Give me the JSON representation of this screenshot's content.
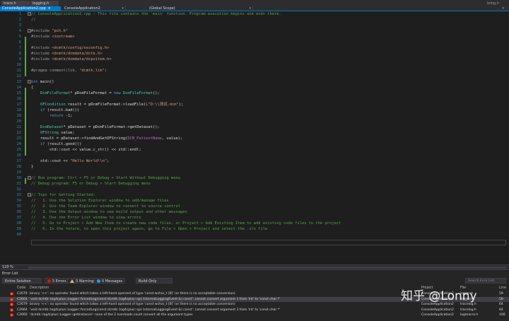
{
  "tabs": [
    {
      "label": "trace.h",
      "active": false
    },
    {
      "label": "logging.h",
      "active": false
    },
    {
      "label": "ConsoleApplication2.cpp",
      "active": true,
      "close": "×"
    }
  ],
  "tabbar_right": "tolog.h",
  "navbar": {
    "project": "ConsoleApplication2",
    "scope": "(Global Scope)",
    "dropdown_glyph": "▾"
  },
  "code_lines": [
    {
      "n": "1",
      "parts": [
        {
          "c": "c-comment",
          "t": "// ConsoleApplication2.cpp : This file contains the 'main' function. Program execution begins and ends there."
        }
      ]
    },
    {
      "n": "2",
      "parts": [
        {
          "c": "c-comment",
          "t": "//"
        }
      ]
    },
    {
      "n": "3",
      "parts": []
    },
    {
      "n": "4",
      "parts": [
        {
          "c": "c-pre",
          "t": "#include "
        },
        {
          "c": "c-str",
          "t": "\"pch.h\""
        }
      ]
    },
    {
      "n": "5",
      "parts": [
        {
          "c": "c-pre",
          "t": "#include "
        },
        {
          "c": "c-str",
          "t": "<iostream>"
        }
      ]
    },
    {
      "n": "6",
      "parts": []
    },
    {
      "n": "7",
      "parts": [
        {
          "c": "c-pre",
          "t": "#include "
        },
        {
          "c": "c-str",
          "t": "<dcmtk/config/osconfig.h>"
        }
      ]
    },
    {
      "n": "8",
      "parts": [
        {
          "c": "c-pre",
          "t": "#include "
        },
        {
          "c": "c-str",
          "t": "<dcmtk/dcmdata/dctk.h>"
        }
      ]
    },
    {
      "n": "9",
      "parts": [
        {
          "c": "c-pre",
          "t": "#include "
        },
        {
          "c": "c-str",
          "t": "<dcmtk/dcmdata/dcpxitem.h>"
        }
      ]
    },
    {
      "n": "10",
      "parts": []
    },
    {
      "n": "11",
      "parts": [
        {
          "c": "c-pre",
          "t": "#pragma "
        },
        {
          "c": "c-pre",
          "t": "comment(lib, "
        },
        {
          "c": "c-str",
          "t": "\"dcmtk.lib\""
        },
        {
          "c": "c-pre",
          "t": ")"
        }
      ]
    },
    {
      "n": "12",
      "parts": []
    },
    {
      "n": "13",
      "parts": [
        {
          "c": "c-kw",
          "t": "int"
        },
        {
          "c": "c-txt",
          "t": " main()"
        }
      ]
    },
    {
      "n": "14",
      "parts": [
        {
          "c": "c-txt",
          "t": "{"
        }
      ]
    },
    {
      "n": "15",
      "parts": [
        {
          "c": "c-txt",
          "t": "    "
        },
        {
          "c": "c-type",
          "t": "DcmFileFormat"
        },
        {
          "c": "c-txt",
          "t": "* pDcmFileFormat = "
        },
        {
          "c": "c-kw",
          "t": "new"
        },
        {
          "c": "c-txt",
          "t": " "
        },
        {
          "c": "c-type",
          "t": "DcmFileFormat"
        },
        {
          "c": "c-txt",
          "t": "();"
        }
      ]
    },
    {
      "n": "16",
      "parts": []
    },
    {
      "n": "17",
      "parts": [
        {
          "c": "c-txt",
          "t": "    "
        },
        {
          "c": "c-type",
          "t": "OFCondition"
        },
        {
          "c": "c-txt",
          "t": " result = pDcmFileFormat->loadFile("
        },
        {
          "c": "c-str",
          "t": "L\"D:\\\\测试.dcm\""
        },
        {
          "c": "c-txt",
          "t": ");"
        }
      ]
    },
    {
      "n": "18",
      "parts": [
        {
          "c": "c-txt",
          "t": "    "
        },
        {
          "c": "c-kw",
          "t": "if"
        },
        {
          "c": "c-txt",
          "t": " (result.bad())"
        }
      ]
    },
    {
      "n": "19",
      "parts": [
        {
          "c": "c-txt",
          "t": "        "
        },
        {
          "c": "c-kw",
          "t": "return"
        },
        {
          "c": "c-txt",
          "t": " -1;"
        }
      ]
    },
    {
      "n": "20",
      "parts": []
    },
    {
      "n": "21",
      "parts": [
        {
          "c": "c-txt",
          "t": "    "
        },
        {
          "c": "c-type",
          "t": "DcmDataset"
        },
        {
          "c": "c-txt",
          "t": "* pDataset = pDcmFileFormat->getDataset();"
        }
      ]
    },
    {
      "n": "22",
      "parts": [
        {
          "c": "c-txt",
          "t": "    "
        },
        {
          "c": "c-type",
          "t": "OFString"
        },
        {
          "c": "c-txt",
          "t": " value;"
        }
      ]
    },
    {
      "n": "23",
      "parts": [
        {
          "c": "c-txt",
          "t": "    result = pDataset->findAndGetOFString("
        },
        {
          "c": "c-macro",
          "t": "DCM_PatientName"
        },
        {
          "c": "c-txt",
          "t": ", value);"
        }
      ]
    },
    {
      "n": "24",
      "parts": [
        {
          "c": "c-txt",
          "t": "    "
        },
        {
          "c": "c-kw",
          "t": "if"
        },
        {
          "c": "c-txt",
          "t": " (result.good())"
        }
      ]
    },
    {
      "n": "25",
      "parts": [
        {
          "c": "c-txt",
          "t": "        std::cout << value.c_str() << std::endl;"
        }
      ]
    },
    {
      "n": "26",
      "parts": []
    },
    {
      "n": "27",
      "parts": [
        {
          "c": "c-txt",
          "t": "    std::cout << "
        },
        {
          "c": "c-str",
          "t": "\"Hello World!\\n\""
        },
        {
          "c": "c-txt",
          "t": ";"
        }
      ]
    },
    {
      "n": "28",
      "parts": [
        {
          "c": "c-txt",
          "t": "}"
        }
      ]
    },
    {
      "n": "29",
      "parts": []
    },
    {
      "n": "30",
      "parts": [
        {
          "c": "c-comment",
          "t": "// Run program: Ctrl + F5 or Debug > Start Without Debugging menu"
        }
      ]
    },
    {
      "n": "31",
      "parts": [
        {
          "c": "c-comment",
          "t": "// Debug program: F5 or Debug > Start Debugging menu"
        }
      ]
    },
    {
      "n": "32",
      "parts": []
    },
    {
      "n": "33",
      "parts": [
        {
          "c": "c-comment",
          "t": "// Tips for Getting Started:"
        }
      ]
    },
    {
      "n": "34",
      "parts": [
        {
          "c": "c-comment",
          "t": "//   1. Use the Solution Explorer window to add/manage files"
        }
      ]
    },
    {
      "n": "35",
      "parts": [
        {
          "c": "c-comment",
          "t": "//   2. Use the Team Explorer window to connect to source control"
        }
      ]
    },
    {
      "n": "36",
      "parts": [
        {
          "c": "c-comment",
          "t": "//   3. Use the Output window to see build output and other messages"
        }
      ]
    },
    {
      "n": "37",
      "parts": [
        {
          "c": "c-comment",
          "t": "//   4. Use the Error List window to view errors"
        }
      ]
    },
    {
      "n": "38",
      "parts": [
        {
          "c": "c-comment",
          "t": "//   5. Go to Project > Add New Item to create new code files, or Project > Add Existing Item to add existing code files to the project"
        }
      ]
    },
    {
      "n": "39",
      "parts": [
        {
          "c": "c-comment",
          "t": "//   6. In the future, to open this project again, go to File > Open > Project and select the .sln file"
        }
      ]
    },
    {
      "n": "40",
      "parts": []
    }
  ],
  "fold_glyph": "−",
  "zoom": "120 %",
  "error_list": {
    "title": "Error List",
    "scope": "Entire Solution",
    "errors_btn": "5 Errors",
    "warnings_btn": "0 Warnings",
    "messages_btn": "0 Messages",
    "build_filter": "Build Only",
    "search_placeholder": "Search Error List",
    "columns": {
      "code": "Code",
      "description": "Description",
      "project": "Project",
      "file": "File",
      "line": "Line"
    },
    "rows": [
      {
        "code": "C2679",
        "desc": "binary '<<': no operator found which takes a left-hand operand of type 'const wchar_t [8]' (or there is no acceptable conversion)",
        "project": "ConsoleApplication2",
        "file": "logger.h",
        "line": "59",
        "sel": false
      },
      {
        "code": "C2664",
        "desc": "'void dcmtk::log4cplus::Logger::forcedLog(const dcmtk::log4cplus::spi::InternalLoggingEvent &) const': cannot convert argument 3 from 'int' to 'const char *'",
        "project": "ConsoleApplication2",
        "file": "logger.h",
        "line": "59",
        "sel": true
      },
      {
        "code": "C2679",
        "desc": "binary '<<': no operator found which takes a left-hand operand of type 'const wchar_t [8]' (or there is no acceptable conversion)",
        "project": "ConsoleApplication2",
        "file": "tracelog.h",
        "line": "64",
        "sel": false
      },
      {
        "code": "C2664",
        "desc": "'void dcmtk::log4cplus::Logger::forcedLog(const dcmtk::log4cplus::spi::InternalLoggingEvent &) const': cannot convert argument 3 from 'int' to 'const char *'",
        "project": "ConsoleApplication2",
        "file": "tracelog.h",
        "line": "64",
        "sel": false
      },
      {
        "code": "C2660",
        "desc": "'dcmtk::log4cplus::Logger::getInstance': none of the 2 overloads could convert all the argument types",
        "project": "ConsoleApplication2",
        "file": "logmacro.h",
        "line": "100",
        "sel": false
      }
    ]
  },
  "watermark": "知乎 @Lonny",
  "colors": {
    "accent": "#007acc",
    "error": "#e51400",
    "comment": "#57a64a",
    "keyword": "#569cd6",
    "type": "#4ec9b0",
    "string": "#d69d85"
  }
}
